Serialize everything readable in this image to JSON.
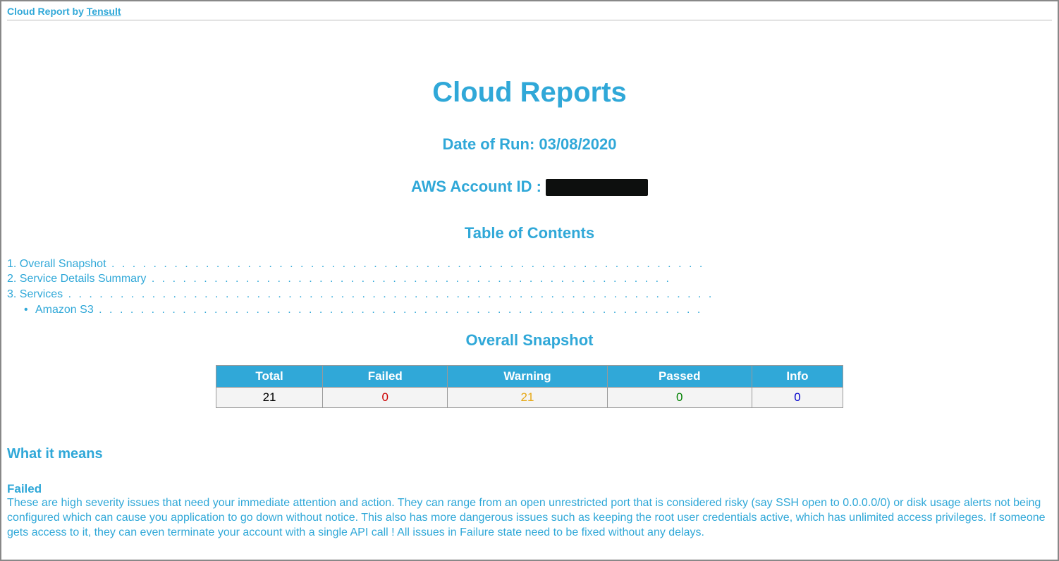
{
  "header": {
    "prefix": "Cloud Report by ",
    "link": "Tensult"
  },
  "title": "Cloud Reports",
  "date_label": "Date of Run: ",
  "date_value": "03/08/2020",
  "account_label": "AWS Account ID : ",
  "toc_heading": "Table of Contents",
  "toc": {
    "item1": "1. Overall Snapshot",
    "item2": "2. Service Details Summary",
    "item3": "3. Services",
    "sub1": "Amazon S3"
  },
  "snapshot_heading": "Overall Snapshot",
  "snapshot_table": {
    "headers": {
      "total": "Total",
      "failed": "Failed",
      "warning": "Warning",
      "passed": "Passed",
      "info": "Info"
    },
    "values": {
      "total": "21",
      "failed": "0",
      "warning": "21",
      "passed": "0",
      "info": "0"
    }
  },
  "what_it_means": "What it means",
  "failed_label": "Failed",
  "failed_desc": "These are high severity issues that need your immediate attention and action. They can range from an open unrestricted port that is considered risky (say SSH open to 0.0.0.0/0) or disk usage alerts not being configured which can cause you application to go down without notice. This also has more dangerous issues such as keeping the root user credentials active, which has unlimited access privileges. If someone gets access to it, they can even terminate your account with a single API call ! All issues in Failure state need to be fixed without any delays.",
  "dots1": "  . . . . . . . . . . . . . . . . . . . . . . . . . . . . . . . . . . . . . . . . . . . . . . . . . . . . . . . . .",
  "dots2": " . . . . . . . . . . . . . . . . . . . . . . . . . . . . . . . . . . . . . . . . . . . . . . . . . .",
  "dots3": "  . . . . . . . . . . . . . . . . . . . . . . . . . . . . . . . . . . . . . . . . . . . . . . . . . . . . . . . . . . . . . .",
  "dots4": " . . . . . . . . . . . . . . . . . . . . . . . . . . . . . . . . . . . . . . . . . . . . . . . . . . . . . . . . . ."
}
